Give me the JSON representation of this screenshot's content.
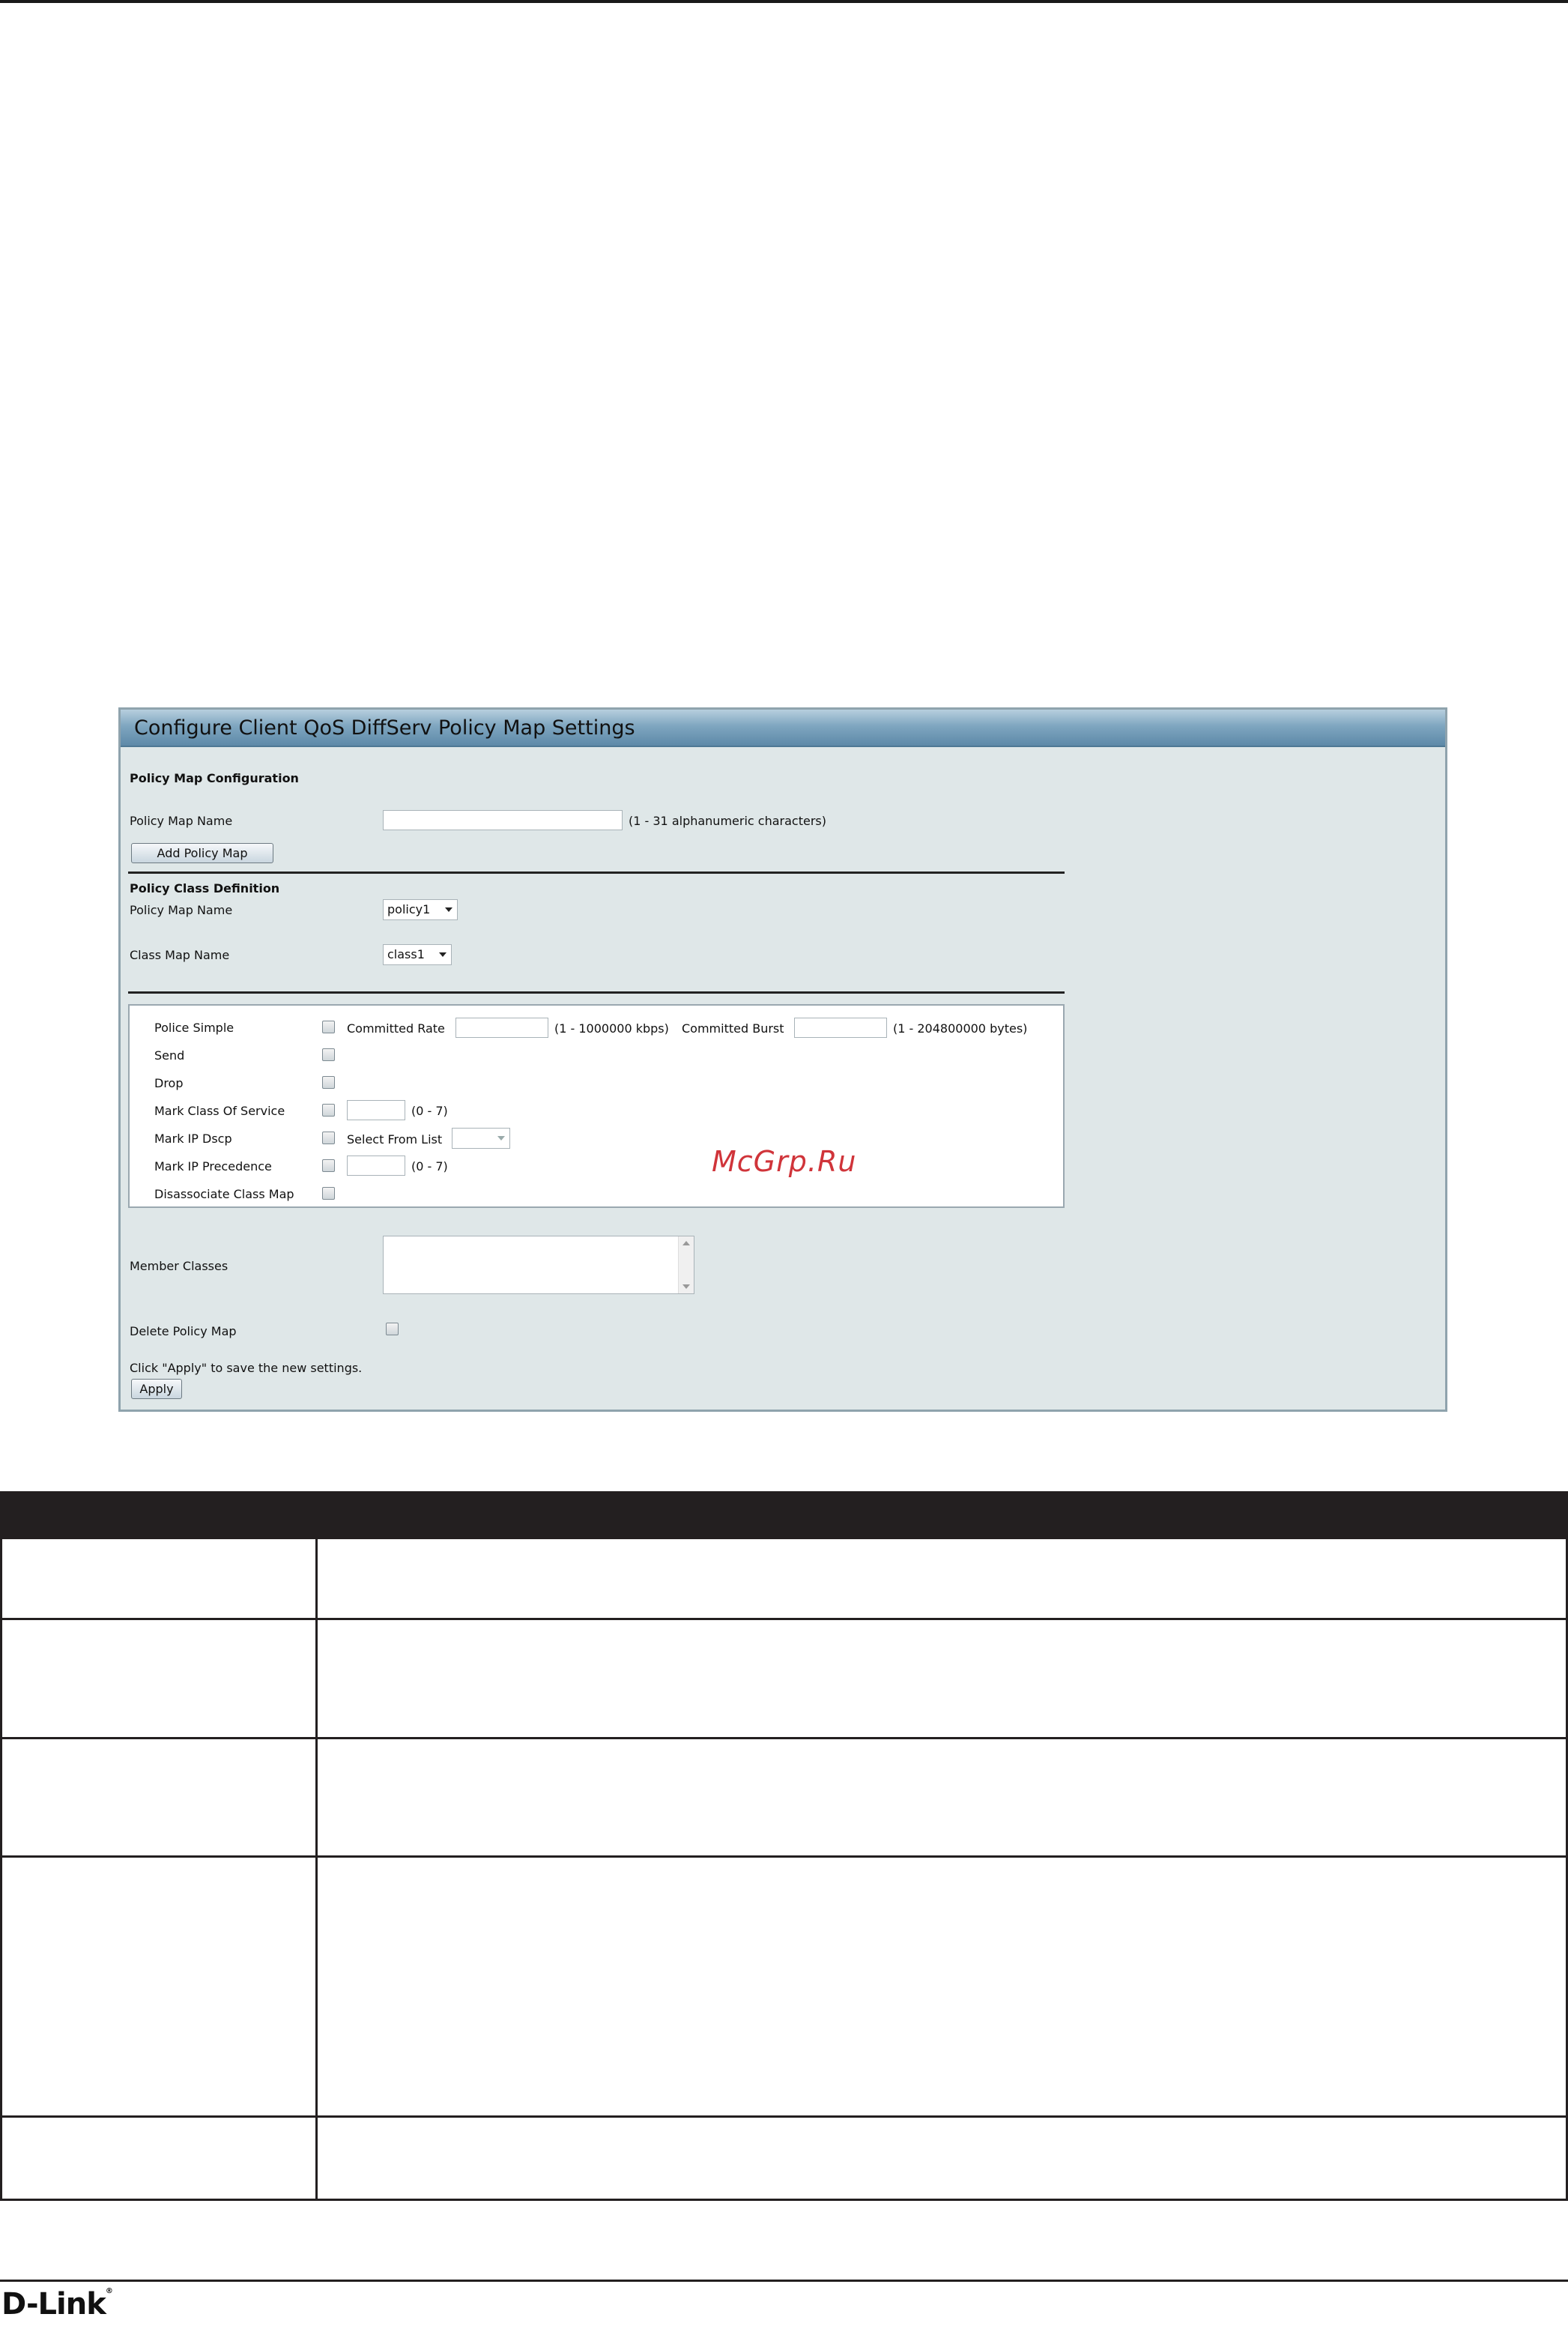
{
  "panel": {
    "title": "Configure Client QoS DiffServ Policy Map Settings",
    "section_policy_map": "Policy Map Configuration",
    "policy_map_name_label": "Policy Map Name",
    "policy_map_name_value": "",
    "policy_map_name_hint": "(1 - 31 alphanumeric characters)",
    "add_policy_map_button": "Add Policy Map",
    "section_policy_class": "Policy Class Definition",
    "class_policy_map_name_label": "Policy Map Name",
    "class_policy_map_name_value": "policy1",
    "class_map_name_label": "Class Map Name",
    "class_map_name_value": "class1",
    "actions": {
      "police_simple": "Police Simple",
      "committed_rate_label": "Committed Rate",
      "committed_rate_hint": "(1 - 1000000 kbps)",
      "committed_burst_label": "Committed Burst",
      "committed_burst_hint": "(1 - 204800000 bytes)",
      "send": "Send",
      "drop": "Drop",
      "mark_cos": "Mark Class Of Service",
      "mark_cos_hint": "(0 - 7)",
      "mark_ip_dscp": "Mark IP Dscp",
      "select_from_list": "Select From List",
      "mark_ip_precedence": "Mark IP Precedence",
      "mark_ip_precedence_hint": "(0 - 7)",
      "disassociate": "Disassociate Class Map"
    },
    "member_classes_label": "Member Classes",
    "delete_policy_map_label": "Delete Policy Map",
    "apply_hint": "Click \"Apply\" to save the new settings.",
    "apply_button": "Apply"
  },
  "watermark": "McGrp.Ru",
  "footer": {
    "logo": "D-Link",
    "logo_mark": "®"
  }
}
